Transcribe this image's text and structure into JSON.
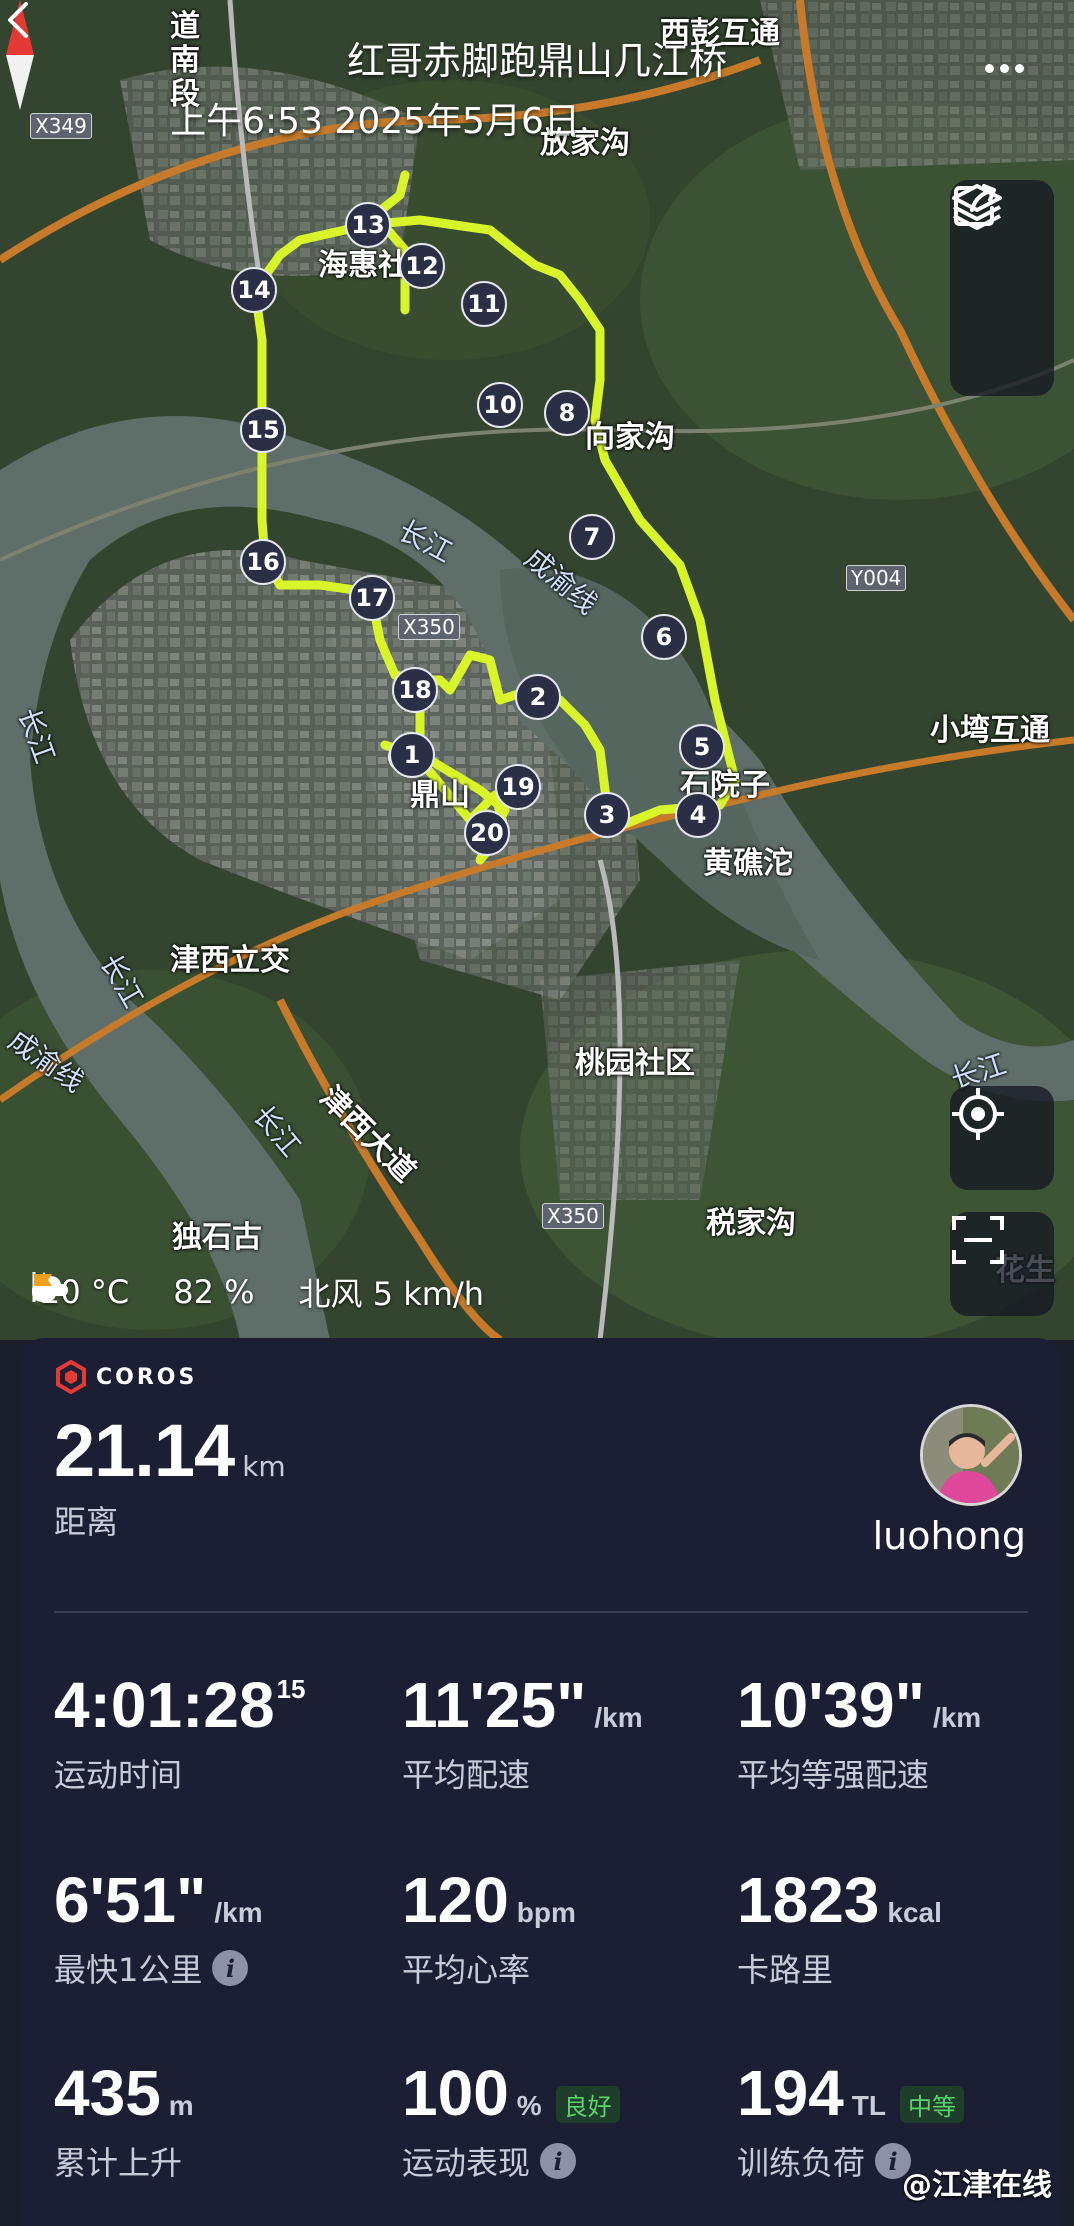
{
  "header": {
    "title": "红哥赤脚跑鼎山几江桥",
    "subtitle": "上午6:53 2025年5月6日"
  },
  "map": {
    "labels": {
      "haihui": "海惠社区",
      "xiangjiagou": "向家沟",
      "changjiang_1": "长江",
      "changjiang_2": "长江",
      "changjiang_3": "长江",
      "changjiang_4": "长江",
      "changjiang_5": "长江",
      "chengyu_1": "成渝线",
      "chengyu_2": "成渝线",
      "shiyuanzi": "石院子",
      "huangchutuo": "黄礁沱",
      "dingshan": "鼎山",
      "jinxilijiao": "津西立交",
      "taoyuan": "桃园社区",
      "jinxidadao": "津西大道",
      "dushigu": "独石古",
      "shuijiagou": "税家沟",
      "xiaowan": "小塆互通",
      "xipeng": "西彭互通",
      "fangjiagou": "放家沟",
      "daonan": "道南段",
      "huasheng": "花生"
    },
    "roads": {
      "x349": "X349",
      "x350a": "X350",
      "x350b": "X350",
      "y004": "Y004"
    },
    "waypoints": [
      "1",
      "2",
      "3",
      "4",
      "5",
      "6",
      "7",
      "8",
      "10",
      "11",
      "12",
      "13",
      "14",
      "15",
      "16",
      "17",
      "18",
      "19",
      "20"
    ],
    "icons": {
      "back": "chevron-left-icon",
      "more": "more-icon",
      "share": "share-icon",
      "layers": "layers-icon",
      "locate": "locate-icon",
      "fit": "fit-screen-icon",
      "compass": "compass-icon"
    }
  },
  "weather": {
    "temp": "20 °C",
    "humidity": "82 %",
    "wind": "北风 5 km/h"
  },
  "card": {
    "brand": "COROS",
    "distance_value": "21.14",
    "distance_unit": "km",
    "distance_label": "距离",
    "username": "luohong",
    "stats": [
      {
        "value": "4:01:28",
        "sup": "15",
        "unit": "",
        "label": "运动时间",
        "badge": "",
        "info": false
      },
      {
        "value": "11'25\"",
        "sup": "",
        "unit": "/km",
        "label": "平均配速",
        "badge": "",
        "info": false
      },
      {
        "value": "10'39\"",
        "sup": "",
        "unit": "/km",
        "label": "平均等强配速",
        "badge": "",
        "info": false
      },
      {
        "value": "6'51\"",
        "sup": "",
        "unit": "/km",
        "label": "最快1公里",
        "badge": "",
        "info": true
      },
      {
        "value": "120",
        "sup": "",
        "unit": "bpm",
        "label": "平均心率",
        "badge": "",
        "info": false
      },
      {
        "value": "1823",
        "sup": "",
        "unit": "kcal",
        "label": "卡路里",
        "badge": "",
        "info": false
      },
      {
        "value": "435",
        "sup": "",
        "unit": "m",
        "label": "累计上升",
        "badge": "",
        "info": false
      },
      {
        "value": "100",
        "sup": "",
        "unit": "%",
        "label": "运动表现",
        "badge": "良好",
        "info": true
      },
      {
        "value": "194",
        "sup": "",
        "unit": "TL",
        "label": "训练负荷",
        "badge": "中等",
        "info": true
      }
    ]
  },
  "watermark": "@江津在线",
  "colors": {
    "route": "#d8f52a",
    "card_bg": "#1c1f33",
    "badge_green": "#59d36b"
  }
}
